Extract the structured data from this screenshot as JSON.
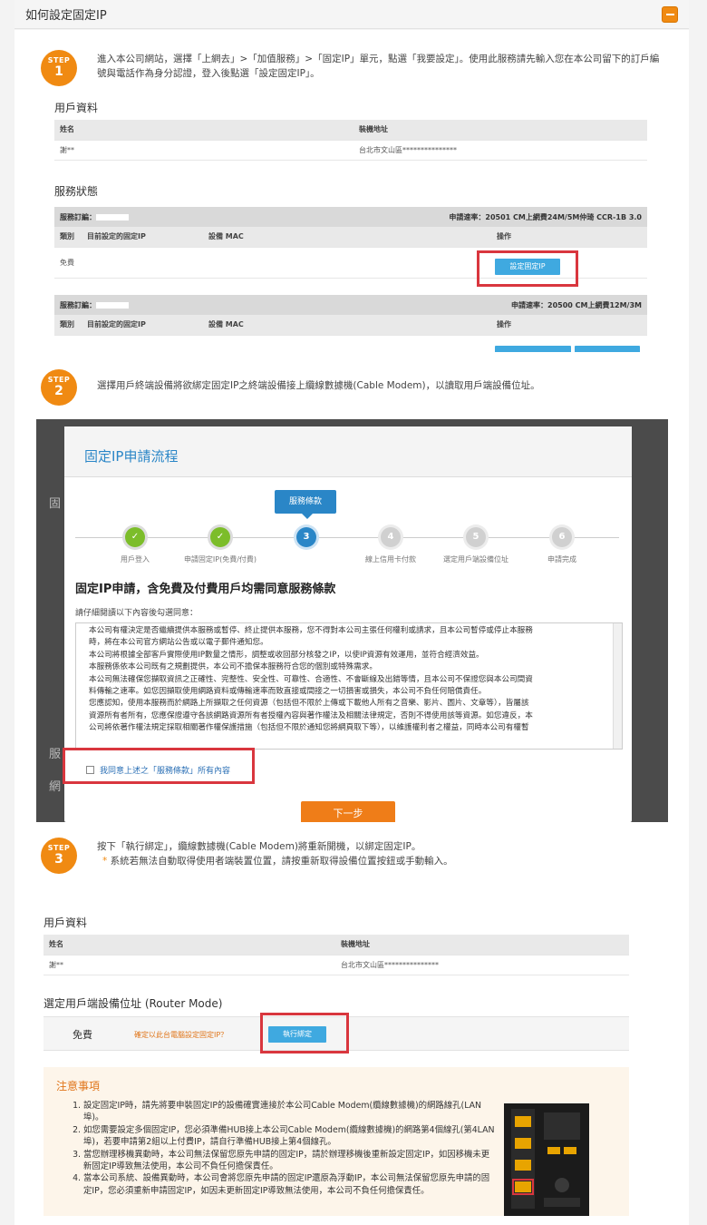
{
  "header": {
    "title": "如何設定固定IP"
  },
  "steps": [
    {
      "label": "STEP",
      "num": "1",
      "text": "進入本公司網站，選擇「上網去」>「加值服務」>「固定IP」單元，點選「我要設定」。使用此服務請先輸入您在本公司留下的訂戶編號與電話作為身分認證，登入後點選「設定固定IP」。"
    },
    {
      "label": "STEP",
      "num": "2",
      "text": "選擇用戶終端設備將欲綁定固定IP之終端設備接上纜線數據機(Cable Modem)，以讀取用戶端設備位址。"
    },
    {
      "label": "STEP",
      "num": "3",
      "text": "按下「執行綁定」，纜線數據機(Cable Modem)將重新開機，以綁定固定IP。",
      "note": "系統若無法自動取得使用者端裝置位置，請按重新取得設備位置按鈕或手動輸入。"
    }
  ],
  "shot1": {
    "user_title": "用戶資料",
    "user_headers": [
      "姓名",
      "裝機地址"
    ],
    "user_row": [
      "謝**",
      "台北市文山區***************"
    ],
    "service_title": "服務狀態",
    "sub1_left": "服務訂編：",
    "sub1_right": "申請速率：20501 CM上網費24M/5M仲琦 CCR-1B 3.0",
    "cols": [
      "類別",
      "目前設定的固定IP",
      "設備 MAC",
      "操作"
    ],
    "row1_type": "免費",
    "set_ip_btn": "設定固定IP",
    "sub2_left": "服務訂編：",
    "sub2_right": "申請速率：20500 CM上網費12M/3M",
    "cols2": [
      "類別",
      "目前設定的固定IP",
      "設備 MAC",
      "操作"
    ]
  },
  "shot2": {
    "modal_title": "固定IP申請流程",
    "bubble": "服務條款",
    "progress": [
      {
        "label": "用戶登入",
        "num": "✓",
        "state": "done"
      },
      {
        "label": "申請固定IP(免費/付費)",
        "num": "✓",
        "state": "done"
      },
      {
        "label": "",
        "num": "3",
        "state": "cur"
      },
      {
        "label": "線上信用卡付款",
        "num": "4",
        "state": "todo"
      },
      {
        "label": "選定用戶端設備位址",
        "num": "5",
        "state": "todo"
      },
      {
        "label": "申請完成",
        "num": "6",
        "state": "todo"
      }
    ],
    "terms_heading": "固定IP申請，含免費及付費用戶均需同意服務條款",
    "terms_sub": "請仔細閱讀以下內容後勾選同意：",
    "terms_lines": [
      "本公司有權決定是否繼續提供本服務或暫停、終止提供本服務，您不得對本公司主張任何權利或請求，且本公司暫停或停止本服務",
      "時，將在本公司官方網站公告或以電子郵件通知您。",
      "本公司將根據全部客戶實際使用IP數量之情形，調整或收回部分核發之IP，以使IP資源有效運用，並符合經濟效益。",
      "本服務係依本公司既有之規劃提供，本公司不擔保本服務符合您的個別或特殊需求。",
      "本公司無法確保您擷取資訊之正確性、完整性、安全性、可靠性、合適性、不會斷線及出錯等情，且本公司不保證您與本公司間資",
      "料傳輸之速率。如您因擷取使用網路資料或傳輸速率而致直接或間接之一切損害或損失，本公司不負任何賠償責任。",
      "您應認知，使用本服務而於網路上所擷取之任何資源（包括但不限於上傳或下載他人所有之音樂、影片、圖片、文章等），皆屬該",
      "資源所有者所有，您應保證遵守各該網路資源所有者授權內容與著作權法及相關法律規定，否則不得使用該等資源。如您違反，本",
      "公司將依著作權法規定採取相關著作權保護措施（包括但不限於通知您將網頁取下等），以維護權利者之權益，同時本公司有權暫"
    ],
    "agree_label": "我同意上述之「服務條款」所有內容",
    "next_btn": "下一步"
  },
  "shot3": {
    "user_title": "用戶資料",
    "user_headers": [
      "姓名",
      "裝機地址"
    ],
    "user_row": [
      "謝**",
      "台北市文山區***************"
    ],
    "router_title": "選定用戶端設備位址 (Router Mode)",
    "router_type": "免費",
    "router_q": "確定以此台電腦設定固定IP？",
    "bind_btn": "執行綁定",
    "notice_title": "注意事項",
    "notices": [
      "設定固定IP時，請先將要申裝固定IP的設備確實連接於本公司Cable Modem(纜線數據機)的網路線孔(LAN 埠)。",
      "如您需要設定多個固定IP，您必須準備HUB接上本公司Cable Modem(纜線數據機)的網路第4個線孔(第4LAN 埠)，若要申請第2組以上付費IP，請自行準備HUB接上第4個線孔。",
      "當您辦理移機異動時，本公司無法保留您原先申請的固定IP，請於辦理移機後重新設定固定IP，如因移機未更新固定IP導致無法使用，本公司不負任何擔保責任。",
      "當本公司系統、設備異動時，本公司會將您原先申請的固定IP還原為浮動IP，本公司無法保留您原先申請的固定IP，您必須重新申請固定IP，如因未更新固定IP導致無法使用，本公司不負任何擔保責任。"
    ]
  },
  "colors": {
    "accent": "#f08a12",
    "blue": "#2a86c7",
    "button_blue": "#3fa9e0",
    "highlight_red": "#d9363e",
    "check_green": "#7cbd2a"
  }
}
